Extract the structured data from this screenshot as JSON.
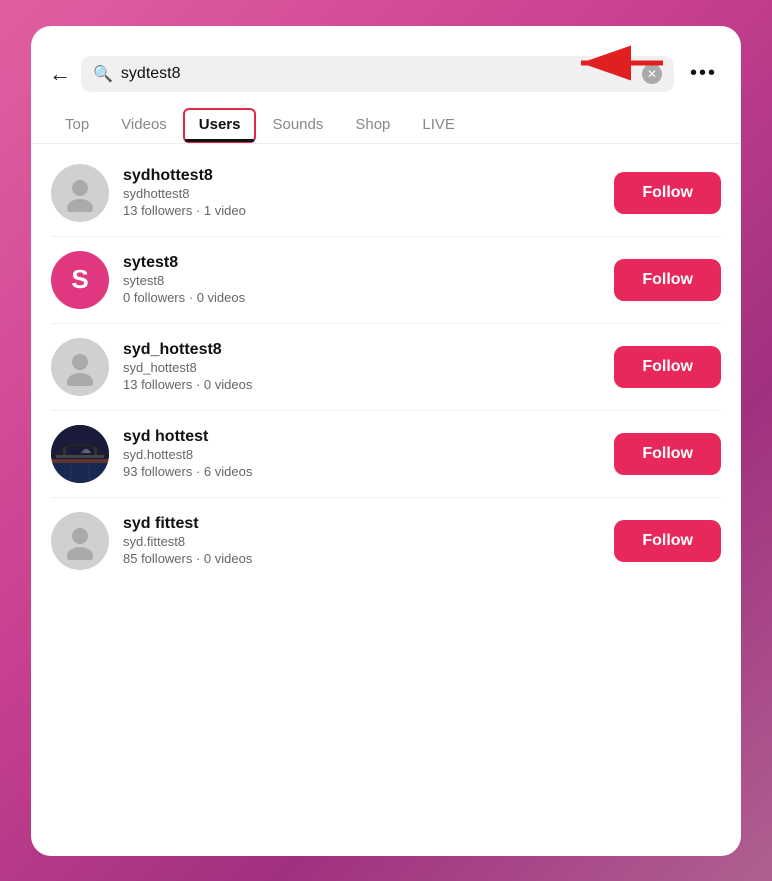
{
  "header": {
    "search_value": "sydtest8",
    "clear_icon": "✕",
    "more_icon": "•••"
  },
  "tabs": [
    {
      "label": "Top",
      "active": false
    },
    {
      "label": "Videos",
      "active": false
    },
    {
      "label": "Users",
      "active": true
    },
    {
      "label": "Sounds",
      "active": false
    },
    {
      "label": "Shop",
      "active": false
    },
    {
      "label": "LIVE",
      "active": false
    }
  ],
  "users": [
    {
      "name": "sydhottest8",
      "handle": "sydhottest8",
      "stats": "13 followers · 1 video",
      "avatar_type": "default",
      "follow_label": "Follow"
    },
    {
      "name": "sytest8",
      "handle": "sytest8",
      "stats": "0 followers · 0 videos",
      "avatar_type": "letter",
      "avatar_letter": "S",
      "follow_label": "Follow"
    },
    {
      "name": "syd_hottest8",
      "handle": "syd_hottest8",
      "stats": "13 followers · 0 videos",
      "avatar_type": "default",
      "follow_label": "Follow"
    },
    {
      "name": "syd hottest",
      "handle": "syd.hottest8",
      "stats": "93 followers · 6 videos",
      "avatar_type": "city",
      "follow_label": "Follow"
    },
    {
      "name": "syd fittest",
      "handle": "syd.fittest8",
      "stats": "85 followers · 0 videos",
      "avatar_type": "default",
      "follow_label": "Follow"
    }
  ]
}
